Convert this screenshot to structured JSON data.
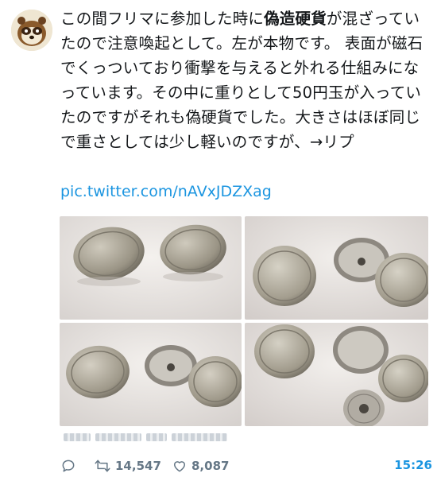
{
  "tweet": {
    "text_before": "この間フリマに参加した時に",
    "text_bold": "偽造硬貨",
    "text_after": "が混ざっていたので注意喚起として。左が本物です。 表面が磁石でくっついており衝撃を与えると外れる仕組みになっています。その中に重りとして50円玉が入っていたのですがそれも偽硬貨でした。大きさはほぼ同じで重さとしては少し軽いのですが、→リプ",
    "link": "pic.twitter.com/nAVxJDZXag"
  },
  "photos": [
    {
      "name": "two-coins-photo"
    },
    {
      "name": "disassembled-coin-photo-1"
    },
    {
      "name": "disassembled-coin-photo-2"
    },
    {
      "name": "disassembled-coin-with-50yen-photo"
    }
  ],
  "actions": {
    "reply_icon": "reply-icon",
    "retweet_icon": "retweet-icon",
    "retweet_count": "14,547",
    "like_icon": "heart-icon",
    "like_count": "8,087",
    "time": "15:26"
  },
  "colors": {
    "link": "#1b95e0",
    "text": "#14171a",
    "muted": "#657786"
  }
}
